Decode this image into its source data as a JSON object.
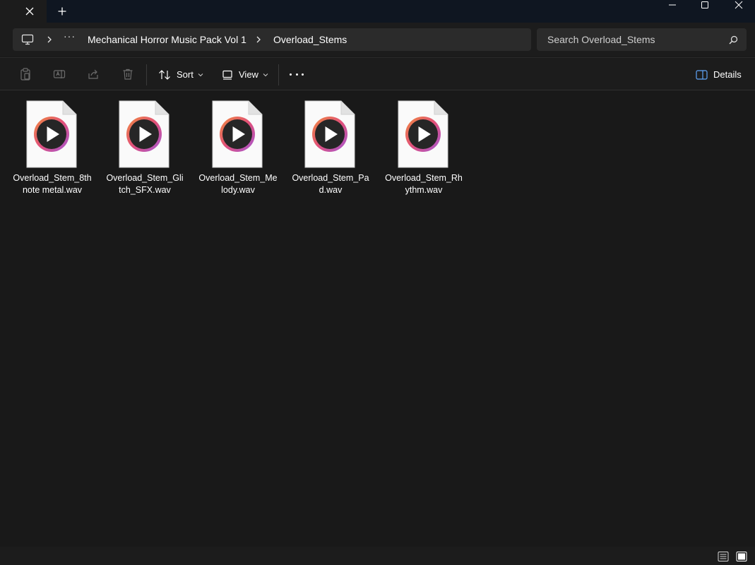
{
  "window": {
    "tab_close_glyph": "✕",
    "new_tab_glyph": "+"
  },
  "address": {
    "more_glyph": "···",
    "breadcrumbs": [
      "Mechanical Horror Music Pack Vol 1",
      "Overload_Stems"
    ]
  },
  "search": {
    "placeholder": "Search Overload_Stems"
  },
  "toolbar": {
    "sort_label": "Sort",
    "view_label": "View",
    "details_label": "Details"
  },
  "files": [
    {
      "name": "Overload_Stem_8th note metal.wav",
      "icon": "audio-file-icon"
    },
    {
      "name": "Overload_Stem_Glitch_SFX.wav",
      "icon": "audio-file-icon"
    },
    {
      "name": "Overload_Stem_Melody.wav",
      "icon": "audio-file-icon"
    },
    {
      "name": "Overload_Stem_Pad.wav",
      "icon": "audio-file-icon"
    },
    {
      "name": "Overload_Stem_Rhythm.wav",
      "icon": "audio-file-icon"
    }
  ],
  "colors": {
    "background": "#191919",
    "titlebar": "#0f1621",
    "field": "#2b2b2b",
    "accent_ring_start": "#f08a3e",
    "accent_ring_end": "#a358d6"
  }
}
